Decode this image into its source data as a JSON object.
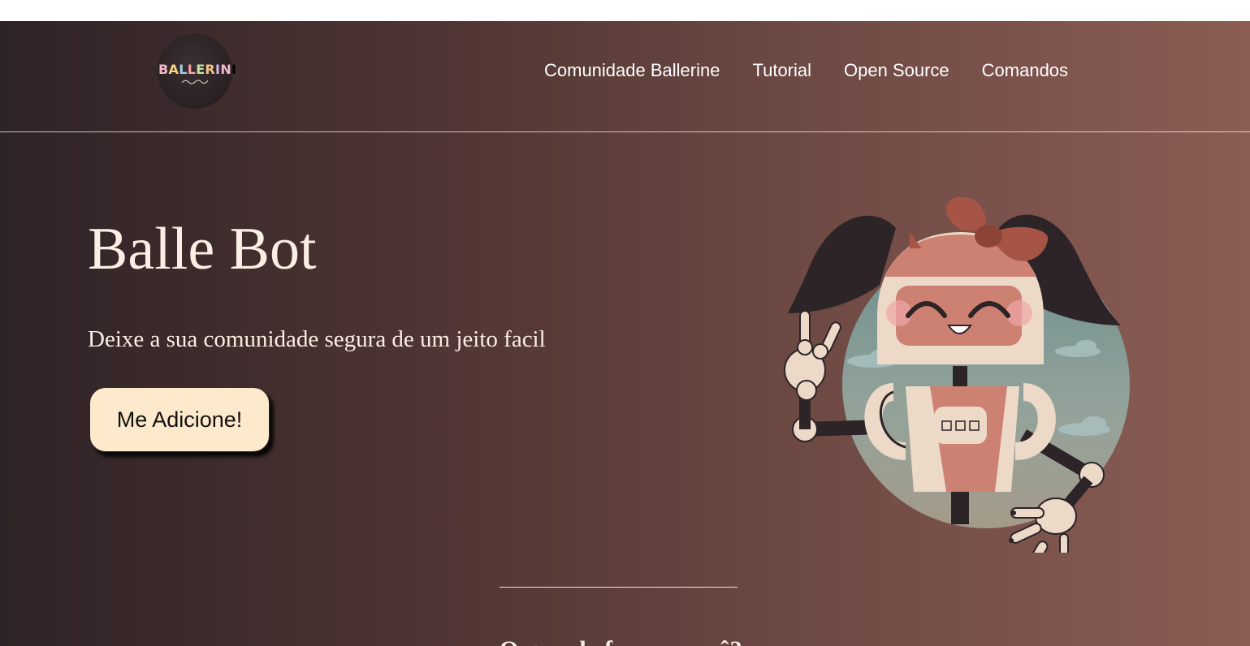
{
  "logo": {
    "text": "BALLERINI"
  },
  "nav": {
    "items": [
      {
        "label": "Comunidade Ballerine"
      },
      {
        "label": "Tutorial"
      },
      {
        "label": "Open Source"
      },
      {
        "label": "Comandos"
      }
    ]
  },
  "hero": {
    "title": "Balle Bot",
    "subtitle": "Deixe a sua comunidade segura de um jeito facil",
    "cta_label": "Me Adicione!"
  },
  "next_section": {
    "heading": "O que ela faz por você?"
  },
  "colors": {
    "gradient_start": "#2e2326",
    "gradient_end": "#8b5d54",
    "text": "#fbeee4",
    "cta_bg": "#fde9cc"
  },
  "icons": [
    "ballerini-logo",
    "robot-mascot-illustration"
  ]
}
